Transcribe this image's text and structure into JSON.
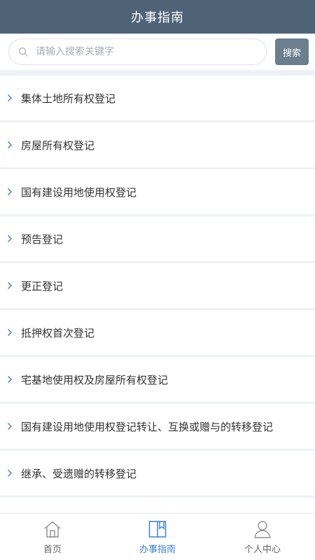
{
  "header": {
    "title": "办事指南"
  },
  "search": {
    "placeholder": "请输入搜索关键字",
    "button_label": "搜索",
    "value": ""
  },
  "guide_list": [
    {
      "label": "集体土地所有权登记"
    },
    {
      "label": "房屋所有权登记"
    },
    {
      "label": "国有建设用地使用权登记"
    },
    {
      "label": "预告登记"
    },
    {
      "label": "更正登记"
    },
    {
      "label": "抵押权首次登记"
    },
    {
      "label": "宅基地使用权及房屋所有权登记"
    },
    {
      "label": "国有建设用地使用权登记转让、互换或赠与的转移登记"
    },
    {
      "label": "继承、受遗赠的转移登记"
    },
    {
      "label": ""
    }
  ],
  "tabbar": {
    "active_color": "#3d7fd6",
    "tabs": [
      {
        "label": "首页",
        "icon": "home-icon",
        "active": false
      },
      {
        "label": "办事指南",
        "icon": "guide-book-icon",
        "active": true
      },
      {
        "label": "个人中心",
        "icon": "user-icon",
        "active": false
      }
    ]
  },
  "colors": {
    "header_bg": "#4f6377",
    "search_button_bg": "#6b7f8f",
    "chevron": "#4a7ac7"
  }
}
